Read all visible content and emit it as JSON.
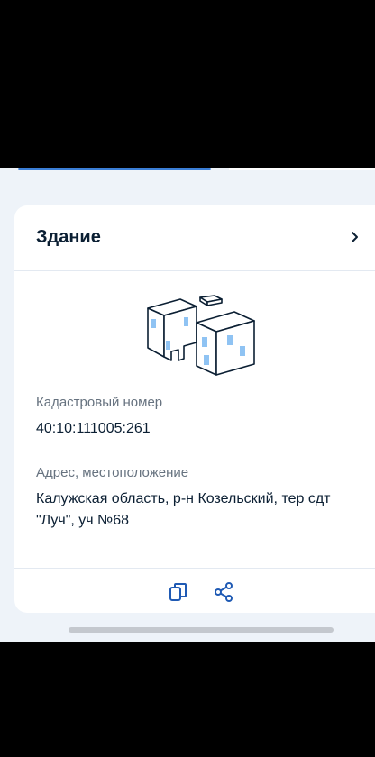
{
  "card": {
    "title": "Здание",
    "chevron_icon": "chevron-right-icon",
    "illustration_icon": "building-illustration-icon",
    "fields": [
      {
        "label": "Кадастровый номер",
        "value": "40:10:111005:261"
      },
      {
        "label": "Адрес, местоположение",
        "value_line1": "Калужская область, р-н Козельский, тер сдт",
        "value_line2": "\"Луч\", уч №68"
      }
    ],
    "actions": [
      {
        "icon": "copy-icon"
      },
      {
        "icon": "share-icon"
      }
    ]
  },
  "colors": {
    "accent": "#3b7ed6",
    "page_background": "#eef3f9",
    "card_background": "#ffffff",
    "title_text": "#0b1f33",
    "secondary_text": "#66727f"
  }
}
